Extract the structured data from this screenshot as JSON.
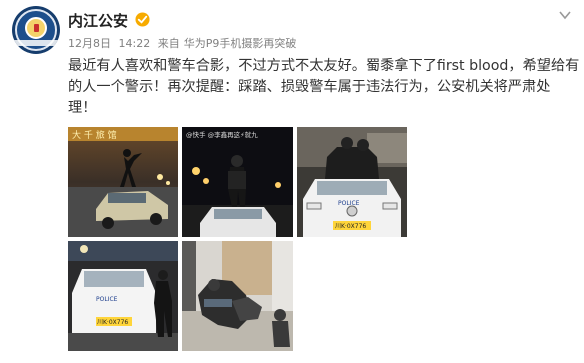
{
  "post": {
    "author": "内江公安",
    "date": "12月8日",
    "time": "14:22",
    "source_prefix": "来自",
    "source": "华为P9手机摄影再突破",
    "text_lines": [
      "最近有人喜欢和警车合影，不过方式不太友好。蜀黍拿下了first blood，希望给有",
      "的人一个警示！再次提醒：踩踏、损毁警车属于违法行为，公安机关将严肃处",
      "理！"
    ]
  },
  "photos": {
    "p1_sign": "大 千 旅 馆",
    "p2_caption": "@快手 @李鑫再这⚡就九",
    "police_label": "POLICE",
    "plate1": "川K·0X776",
    "plate2": "川K·0X776"
  },
  "icons": {
    "verified": "verified-badge-icon",
    "menu": "chevron-down-icon"
  },
  "colors": {
    "verified": "#f7ab00",
    "text": "#333333",
    "meta": "#808080"
  }
}
